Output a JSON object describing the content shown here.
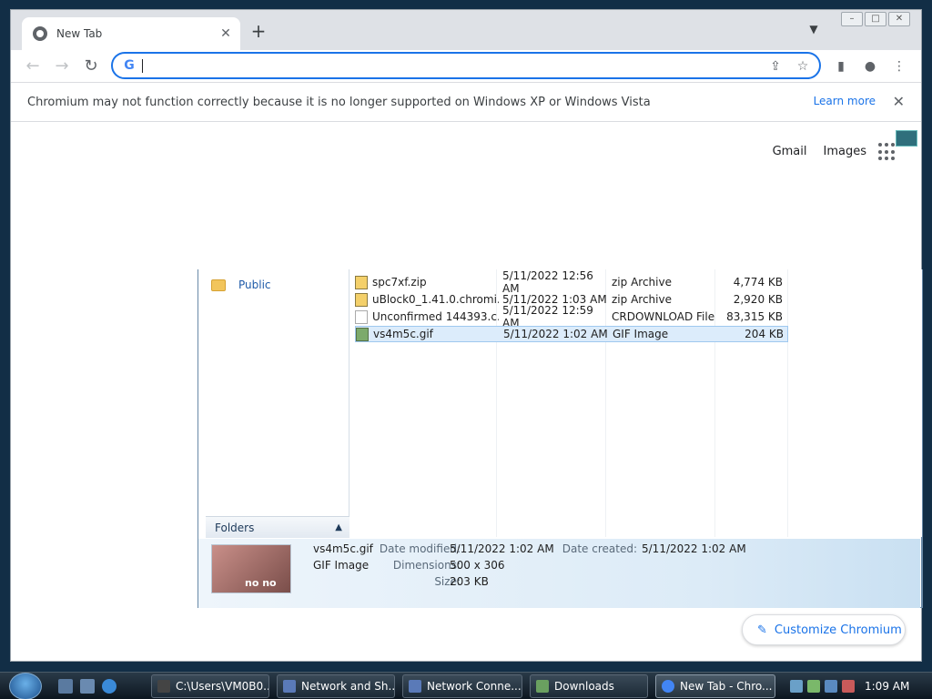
{
  "browser": {
    "tab_title": "New Tab",
    "omnibox_value": "",
    "infobar_text": "Chromium may not function correctly because it is no longer supported on Windows XP or Windows Vista",
    "learn_more": "Learn more",
    "ntp_links": {
      "gmail": "Gmail",
      "images": "Images"
    },
    "customize_label": "Customize Chromium"
  },
  "explorer": {
    "nav_items": [
      {
        "label": "Public"
      }
    ],
    "folders_label": "Folders",
    "files": [
      {
        "name": "spc7xf.zip",
        "date": "5/11/2022 12:56 AM",
        "type": "zip Archive",
        "size": "4,774 KB",
        "icon": "zip-icon"
      },
      {
        "name": "uBlock0_1.41.0.chromi...",
        "date": "5/11/2022 1:03 AM",
        "type": "zip Archive",
        "size": "2,920 KB",
        "icon": "zip-icon"
      },
      {
        "name": "Unconfirmed 144393.c...",
        "date": "5/11/2022 12:59 AM",
        "type": "CRDOWNLOAD File",
        "size": "83,315 KB",
        "icon": "file-icon"
      },
      {
        "name": "vs4m5c.gif",
        "date": "5/11/2022 1:02 AM",
        "type": "GIF Image",
        "size": "204 KB",
        "icon": "image-icon",
        "selected": true
      }
    ],
    "details": {
      "name": "vs4m5c.gif",
      "type": "GIF Image",
      "date_modified_label": "Date modified:",
      "date_modified": "5/11/2022 1:02 AM",
      "date_created_label": "Date created:",
      "date_created": "5/11/2022 1:02 AM",
      "dimensions_label": "Dimensions:",
      "dimensions": "500 x 306",
      "size_label": "Size:",
      "size": "203 KB",
      "thumb_text": "no no"
    }
  },
  "taskbar": {
    "buttons": [
      {
        "label": "C:\\Users\\VM0B0...",
        "color": "#444444"
      },
      {
        "label": "Network and Sh...",
        "color": "#5a7ab8"
      },
      {
        "label": "Network Conne...",
        "color": "#5a7ab8"
      },
      {
        "label": "Downloads",
        "color": "#6aa060"
      },
      {
        "label": "New Tab - Chro...",
        "color": "#4285f4",
        "active": true
      }
    ],
    "clock": "1:09 AM"
  }
}
